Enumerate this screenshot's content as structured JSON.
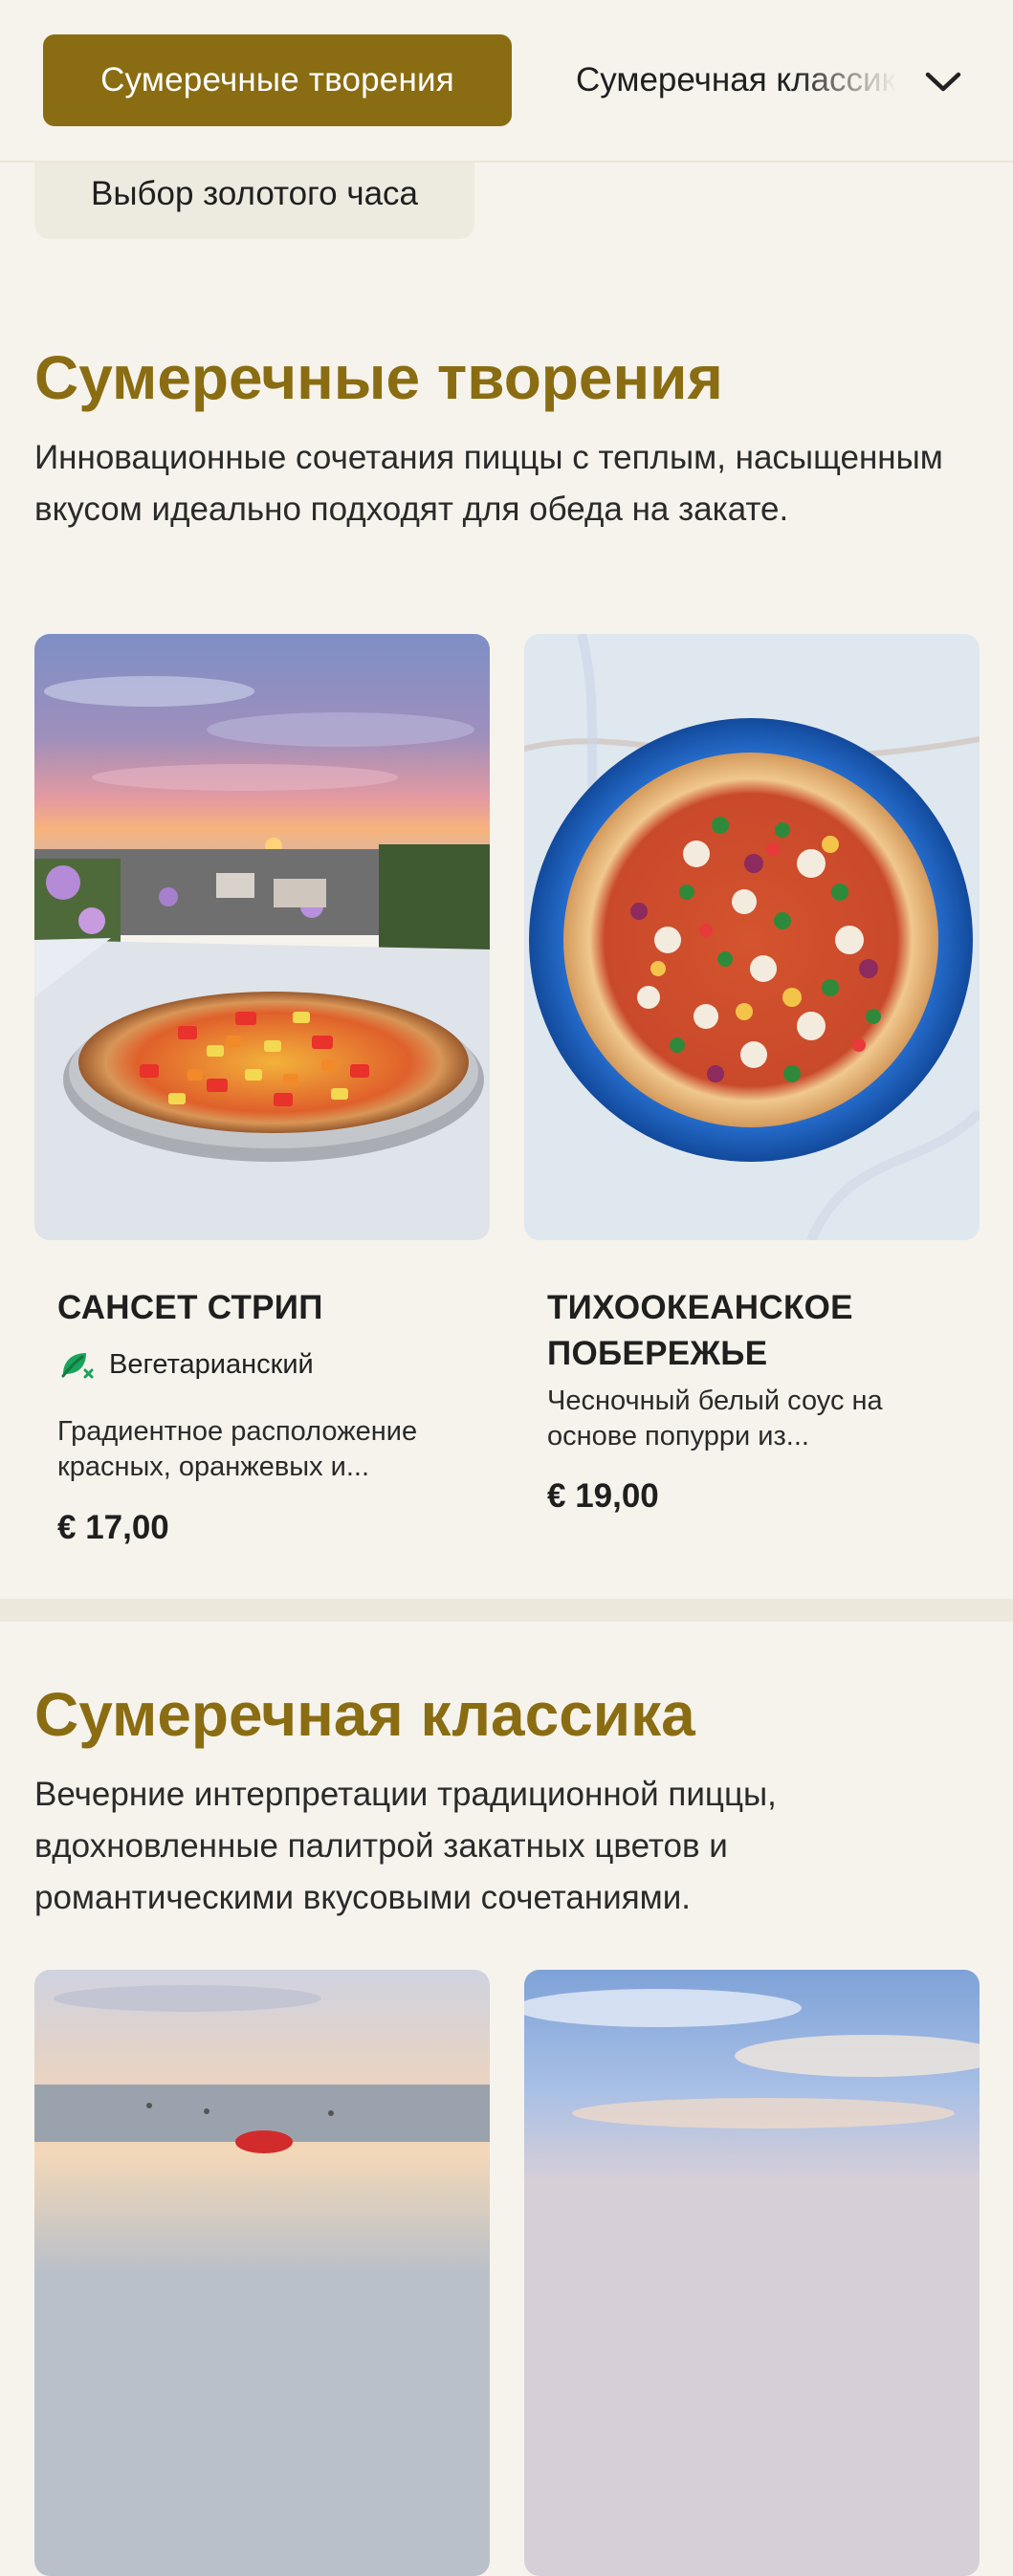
{
  "nav": {
    "active_label": "Сумеречные творения",
    "next_label": "Сумеречная классика",
    "chip_label": "Выбор золотого часа"
  },
  "sections": [
    {
      "title": "Сумеречные творения",
      "description": "Инновационные сочетания пиццы с теплым, насыщенным вкусом идеально подходят для обеда на закате.",
      "items": [
        {
          "name": "САНСЕТ СТРИП",
          "diet": "Вегетарианский",
          "description": "Градиентное расположение красных, оранжевых и...",
          "price": "€ 17,00"
        },
        {
          "name": "ТИХООКЕАНСКОЕ ПОБЕРЕЖЬЕ",
          "description": "Чесночный белый соус на основе попурри из...",
          "price": "€ 19,00"
        }
      ]
    },
    {
      "title": "Сумеречная классика",
      "description": "Вечерние интерпретации традиционной пиццы, вдохновленные палитрой закатных цветов и романтическими вкусовыми сочетаниями."
    }
  ],
  "colors": {
    "accent": "#8a6d12",
    "background": "#f6f3ec",
    "chip_background": "#edeadf",
    "vegetarian_icon": "#1aa35a"
  },
  "icons": {
    "nav_expand": "chevron-down-icon",
    "vegetarian": "leaf-icon"
  }
}
